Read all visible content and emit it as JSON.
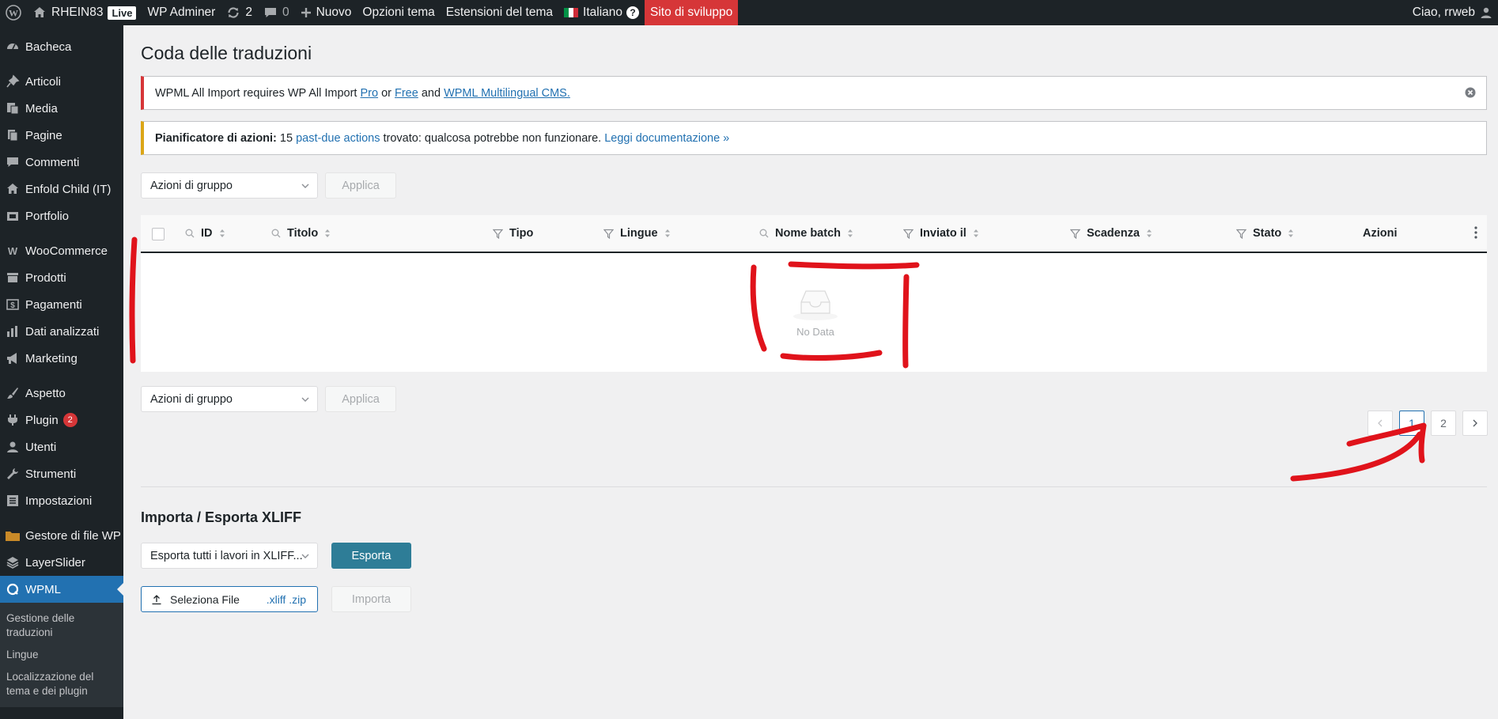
{
  "adminbar": {
    "site_name": "RHEIN83",
    "live_badge": "Live",
    "wp_adminer": "WP Adminer",
    "updates_count": "2",
    "comments_count": "0",
    "new_label": "Nuovo",
    "theme_options": "Opzioni tema",
    "theme_extensions": "Estensioni del tema",
    "language": "Italiano",
    "help": "?",
    "dev_site": "Sito di sviluppo",
    "greeting": "Ciao, rrweb"
  },
  "sidebar": {
    "items": [
      {
        "label": "Bacheca",
        "icon": "dashboard-icon"
      },
      {
        "label": "Articoli",
        "icon": "pin-icon"
      },
      {
        "label": "Media",
        "icon": "media-icon"
      },
      {
        "label": "Pagine",
        "icon": "pages-icon"
      },
      {
        "label": "Commenti",
        "icon": "comment-icon"
      },
      {
        "label": "Enfold Child (IT)",
        "icon": "home-icon"
      },
      {
        "label": "Portfolio",
        "icon": "portfolio-icon"
      },
      {
        "label": "WooCommerce",
        "icon": "woocommerce-icon"
      },
      {
        "label": "Prodotti",
        "icon": "archive-icon"
      },
      {
        "label": "Pagamenti",
        "icon": "payments-icon"
      },
      {
        "label": "Dati analizzati",
        "icon": "chart-bar-icon"
      },
      {
        "label": "Marketing",
        "icon": "megaphone-icon"
      },
      {
        "label": "Aspetto",
        "icon": "paintbrush-icon"
      },
      {
        "label": "Plugin",
        "icon": "plugin-icon",
        "badge": "2"
      },
      {
        "label": "Utenti",
        "icon": "user-icon"
      },
      {
        "label": "Strumenti",
        "icon": "wrench-icon"
      },
      {
        "label": "Impostazioni",
        "icon": "settings-icon"
      },
      {
        "label": "Gestore di file WP",
        "icon": "folder-icon"
      },
      {
        "label": "LayerSlider",
        "icon": "layers-icon"
      },
      {
        "label": "WPML",
        "icon": "wpml-icon"
      }
    ],
    "submenu": [
      "Gestione delle traduzioni",
      "Lingue",
      "Localizzazione del tema e dei plugin"
    ]
  },
  "page": {
    "title": "Coda delle traduzioni",
    "notice_error": {
      "text_before": "WPML All Import requires WP All Import ",
      "link_pro": "Pro",
      "text_or": " or ",
      "link_free": "Free",
      "text_and": " and ",
      "link_wpml": "WPML Multilingual CMS."
    },
    "notice_warning": {
      "label": "Pianificatore di azioni:",
      "count": " 15 ",
      "link_actions": "past-due actions",
      "text": " trovato: qualcosa potrebbe non funzionare. ",
      "link_docs": "Leggi documentazione »"
    },
    "bulk_actions_label": "Azioni di gruppo",
    "apply_label": "Applica",
    "table": {
      "columns": [
        "ID",
        "Titolo",
        "Tipo",
        "Lingue",
        "Nome batch",
        "Inviato il",
        "Scadenza",
        "Stato",
        "Azioni"
      ],
      "empty_text": "No Data"
    },
    "pagination": {
      "pages": [
        "1",
        "2"
      ],
      "current": "1"
    },
    "xliff": {
      "heading": "Importa / Esporta XLIFF",
      "export_select": "Esporta tutti i lavori in XLIFF...",
      "export_button": "Esporta",
      "file_label": "Seleziona File",
      "file_ext": ".xliff .zip",
      "import_button": "Importa"
    }
  },
  "colors": {
    "adminbar_bg": "#1d2327",
    "accent": "#2271b1",
    "dev_site": "#d63638",
    "annotation": "#e0131b"
  }
}
